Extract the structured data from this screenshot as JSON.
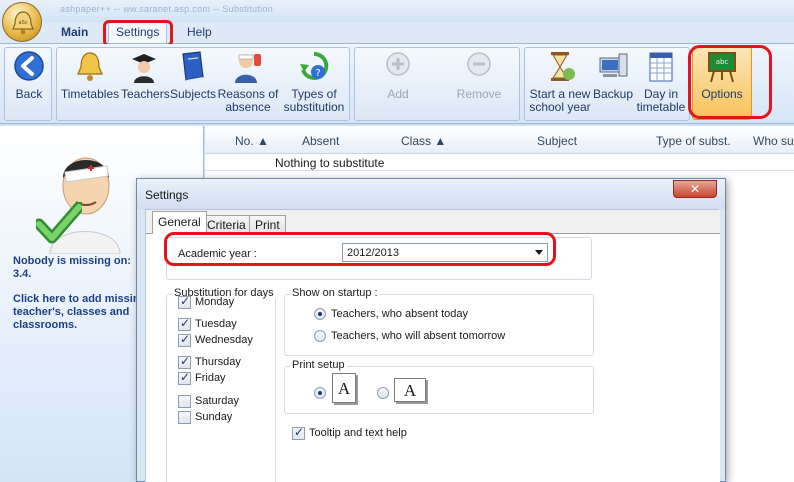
{
  "window": {
    "title_fragment": "ashpaper++ -- ww.saranet.asp.com -- Substitution"
  },
  "menu": {
    "main": "Main",
    "settings": "Settings",
    "help": "Help"
  },
  "ribbon": {
    "back": "Back",
    "timetables": "Timetables",
    "teachers": "Teachers",
    "subjects": "Subjects",
    "reasons_line1": "Reasons of",
    "reasons_line2": "absence",
    "types_line1": "Types of",
    "types_line2": "substitution",
    "add": "Add",
    "remove": "Remove",
    "start_line1": "Start a new",
    "start_line2": "school year",
    "backup": "Backup",
    "day_line1": "Day in",
    "day_line2": "timetable",
    "options": "Options"
  },
  "left_panel": {
    "status_line1": "Nobody is missing on:",
    "status_line2": "3.4.",
    "hint_line1": "Click here to add missin",
    "hint_line2": "teacher's, classes and",
    "hint_line3": "classrooms."
  },
  "list": {
    "columns": {
      "no": "No. ▲",
      "absent": "Absent",
      "class": "Class ▲",
      "subject": "Subject",
      "type": "Type of subst.",
      "who": "Who su"
    },
    "empty_text": "Nothing to substitute"
  },
  "dialog": {
    "title": "Settings",
    "close": "✕",
    "tabs": {
      "general": "General",
      "criteria": "Criteria",
      "print": "Print"
    },
    "academic_year_label": "Academic year :",
    "academic_year_value": "2012/2013",
    "substitution_days_label": "Substitution for days",
    "days": [
      {
        "label": "Monday",
        "checked": true
      },
      {
        "label": "Tuesday",
        "checked": true
      },
      {
        "label": "Wednesday",
        "checked": true
      },
      {
        "label": "Thursday",
        "checked": true
      },
      {
        "label": "Friday",
        "checked": true
      },
      {
        "label": "Saturday",
        "checked": false
      },
      {
        "label": "Sunday",
        "checked": false
      }
    ],
    "show_on_startup_label": "Show on startup :",
    "startup_today": "Teachers, who absent today",
    "startup_tomorrow": "Teachers, who will absent tomorrow",
    "print_setup_label": "Print setup",
    "page_glyph": "A",
    "tooltip_label": "Tooltip and text help"
  },
  "colors": {
    "highlight_ring": "#e3141c",
    "accent": "#1d3f8a"
  }
}
